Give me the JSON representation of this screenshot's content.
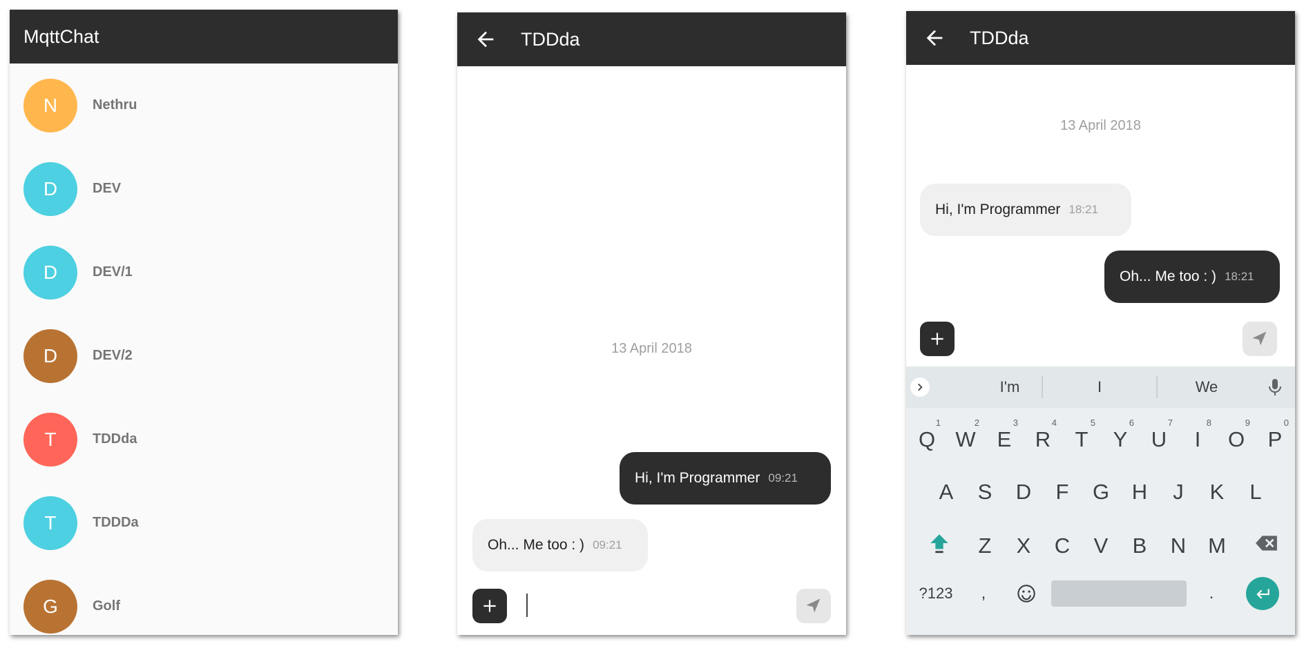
{
  "screen1": {
    "title": "MqttChat",
    "contacts": [
      {
        "initial": "N",
        "name": "Nethru",
        "color": "#FFB74D"
      },
      {
        "initial": "D",
        "name": "DEV",
        "color": "#4DD0E1"
      },
      {
        "initial": "D",
        "name": "DEV/1",
        "color": "#4DD0E1"
      },
      {
        "initial": "D",
        "name": "DEV/2",
        "color": "#B87333"
      },
      {
        "initial": "T",
        "name": "TDDda",
        "color": "#FF6659"
      },
      {
        "initial": "T",
        "name": "TDDDa",
        "color": "#4DD0E1"
      },
      {
        "initial": "G",
        "name": "Golf",
        "color": "#B87333"
      }
    ]
  },
  "screen2": {
    "title": "TDDda",
    "date": "13 April 2018",
    "messages": [
      {
        "text": "Hi, I'm Programmer",
        "time": "09:21",
        "side": "right"
      },
      {
        "text": "Oh... Me too : )",
        "time": "09:21",
        "side": "left"
      }
    ],
    "input_value": ""
  },
  "screen3": {
    "title": "TDDda",
    "date": "13 April 2018",
    "messages": [
      {
        "text": "Hi, I'm Programmer",
        "time": "18:21",
        "side": "left"
      },
      {
        "text": "Oh... Me too : )",
        "time": "18:21",
        "side": "right"
      }
    ],
    "keyboard": {
      "suggestions": [
        "I'm",
        "I",
        "We"
      ],
      "row1": [
        {
          "key": "Q",
          "hint": "1"
        },
        {
          "key": "W",
          "hint": "2"
        },
        {
          "key": "E",
          "hint": "3"
        },
        {
          "key": "R",
          "hint": "4"
        },
        {
          "key": "T",
          "hint": "5"
        },
        {
          "key": "Y",
          "hint": "6"
        },
        {
          "key": "U",
          "hint": "7"
        },
        {
          "key": "I",
          "hint": "8"
        },
        {
          "key": "O",
          "hint": "9"
        },
        {
          "key": "P",
          "hint": "0"
        }
      ],
      "row2": [
        "A",
        "S",
        "D",
        "F",
        "G",
        "H",
        "J",
        "K",
        "L"
      ],
      "row3": [
        "Z",
        "X",
        "C",
        "V",
        "B",
        "N",
        "M"
      ],
      "symbols_label": "?123",
      "comma": ",",
      "period": ".",
      "accent_color": "#26A69A"
    }
  },
  "theme": {
    "appbar": "#2D2D2D",
    "bubble_dark": "#2D2D2D",
    "bubble_light": "#F0F0F0"
  }
}
